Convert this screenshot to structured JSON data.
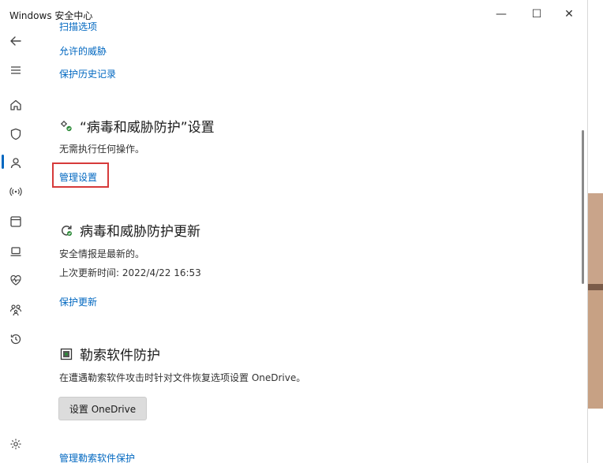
{
  "window": {
    "title": "Windows 安全中心",
    "minimize_glyph": "—",
    "maximize_glyph": "☐",
    "close_glyph": "✕"
  },
  "sidebar": {
    "items": [
      {
        "name": "back-icon"
      },
      {
        "name": "menu-icon"
      },
      {
        "name": "home-icon"
      },
      {
        "name": "shield-icon",
        "active": true
      },
      {
        "name": "account-icon"
      },
      {
        "name": "network-icon"
      },
      {
        "name": "app-browser-icon"
      },
      {
        "name": "device-security-icon"
      },
      {
        "name": "health-icon"
      },
      {
        "name": "family-icon"
      },
      {
        "name": "history-icon"
      },
      {
        "name": "settings-icon"
      }
    ]
  },
  "top_links": {
    "scan_options": "扫描选项",
    "allowed_threats": "允许的威胁",
    "protection_history": "保护历史记录"
  },
  "settings_section": {
    "title": "“病毒和威胁防护”设置",
    "status": "无需执行任何操作。",
    "link": "管理设置"
  },
  "updates_section": {
    "title": "病毒和威胁防护更新",
    "status": "安全情报是最新的。",
    "last_update": "上次更新时间: 2022/4/22 16:53",
    "link": "保护更新"
  },
  "ransomware_section": {
    "title": "勒索软件防护",
    "description": "在遭遇勒索软件攻击时针对文件恢复选项设置 OneDrive。",
    "button": "设置 OneDrive",
    "link": "管理勒索软件保护"
  },
  "colors": {
    "accent": "#0067c0",
    "highlight_box": "#d63a3a",
    "button_bg": "#dcdcdc"
  }
}
